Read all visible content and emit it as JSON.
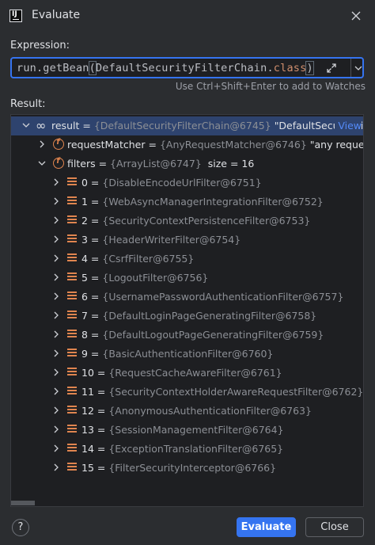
{
  "window": {
    "title": "Evaluate",
    "app_icon_text": "IJ"
  },
  "expression": {
    "label": "Expression:",
    "value_prefix": "run.getBean",
    "value_open": "(",
    "value_arg": "DefaultSecurityFilterChain.",
    "value_kw": "class",
    "value_close": ")",
    "hint": "Use Ctrl+Shift+Enter to add to Watches"
  },
  "result": {
    "label": "Result:",
    "root": {
      "name": "result",
      "ref": "{DefaultSecurityFilterChain@6745}",
      "value": "\"DefaultSecurityFilt...",
      "view_link": "View"
    },
    "children": [
      {
        "name": "requestMatcher",
        "ref": "{AnyRequestMatcher@6746}",
        "value": "\"any request\""
      },
      {
        "name": "filters",
        "ref": "{ArrayList@6747}",
        "value": "size = 16"
      }
    ],
    "filters": [
      {
        "index": "0",
        "ref": "{DisableEncodeUrlFilter@6751}"
      },
      {
        "index": "1",
        "ref": "{WebAsyncManagerIntegrationFilter@6752}"
      },
      {
        "index": "2",
        "ref": "{SecurityContextPersistenceFilter@6753}"
      },
      {
        "index": "3",
        "ref": "{HeaderWriterFilter@6754}"
      },
      {
        "index": "4",
        "ref": "{CsrfFilter@6755}"
      },
      {
        "index": "5",
        "ref": "{LogoutFilter@6756}"
      },
      {
        "index": "6",
        "ref": "{UsernamePasswordAuthenticationFilter@6757}"
      },
      {
        "index": "7",
        "ref": "{DefaultLoginPageGeneratingFilter@6758}"
      },
      {
        "index": "8",
        "ref": "{DefaultLogoutPageGeneratingFilter@6759}"
      },
      {
        "index": "9",
        "ref": "{BasicAuthenticationFilter@6760}"
      },
      {
        "index": "10",
        "ref": "{RequestCacheAwareFilter@6761}"
      },
      {
        "index": "11",
        "ref": "{SecurityContextHolderAwareRequestFilter@6762}"
      },
      {
        "index": "12",
        "ref": "{AnonymousAuthenticationFilter@6763}"
      },
      {
        "index": "13",
        "ref": "{SessionManagementFilter@6764}"
      },
      {
        "index": "14",
        "ref": "{ExceptionTranslationFilter@6765}"
      },
      {
        "index": "15",
        "ref": "{FilterSecurityInterceptor@6766}"
      }
    ]
  },
  "buttons": {
    "help": "?",
    "evaluate": "Evaluate",
    "close": "Close"
  },
  "colors": {
    "accent": "#3574f0",
    "field_icon": "#e0854f",
    "link": "#548af7"
  }
}
